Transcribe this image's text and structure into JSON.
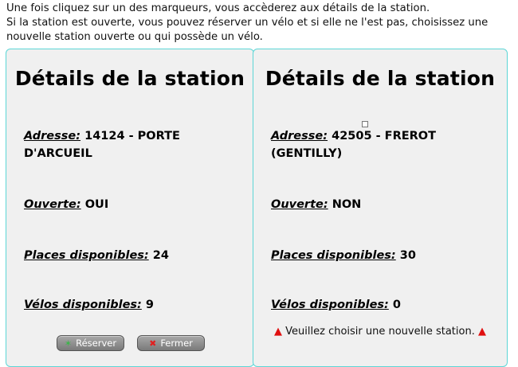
{
  "intro": {
    "line1": "Une fois cliquez sur un des marqueurs, vous accèderez aux détails de la station.",
    "line2": "Si la station est ouverte, vous pouvez réserver un vélo et si elle ne l'est pas, choisissez une",
    "line3": "nouvelle station ouverte ou qui possède un vélo."
  },
  "left_panel": {
    "title": "Détails de la station",
    "address_label": "Adresse:",
    "address_value": "14124 - PORTE",
    "address_value2": "D'ARCUEIL",
    "open_label": "Ouverte:",
    "open_value": "OUI",
    "places_label": "Places disponibles:",
    "places_value": "24",
    "bikes_label": "Vélos disponibles:",
    "bikes_value": "9",
    "reserve_button": "Réserver",
    "close_button": "Fermer"
  },
  "right_panel": {
    "title": "Détails de la station",
    "address_label": "Adresse:",
    "address_value": "42505 - FREROT",
    "address_value2": "(GENTILLY)",
    "open_label": "Ouverte:",
    "open_value": "NON",
    "places_label": "Places disponibles:",
    "places_value": "30",
    "bikes_label": "Vélos disponibles:",
    "bikes_value": "0",
    "warning": "Veuillez choisir une nouvelle station."
  },
  "icons": {
    "bike": "bike-icon",
    "close": "close-icon",
    "warning": "warning-triangle-icon"
  },
  "colors": {
    "panel_border": "#5cd6d6",
    "panel_bg": "#f0f0f0",
    "warning_red": "#e01010",
    "bike_green": "#3bb54a"
  }
}
